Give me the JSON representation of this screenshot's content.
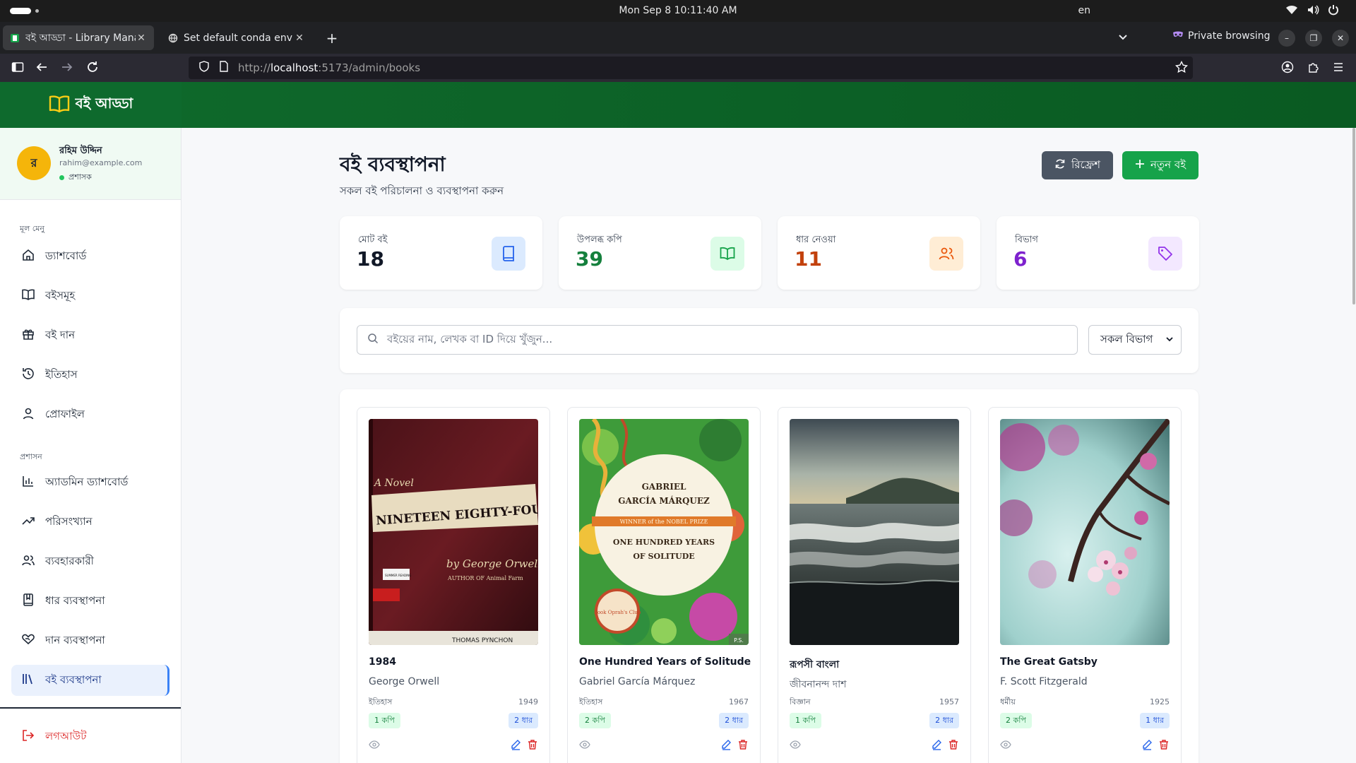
{
  "os": {
    "clock": "Mon Sep 8  10:11:40 AM",
    "lang": "en"
  },
  "browser": {
    "tabs": [
      {
        "title": "বই আড্ডা - Library Management",
        "active": true
      },
      {
        "title": "Set default conda env",
        "active": false
      }
    ],
    "new_tab": "+",
    "private_label": "Private browsing",
    "url_scheme": "http://",
    "url_host": "localhost",
    "url_path": ":5173/admin/books"
  },
  "app": {
    "brand": "বই আড্ডা",
    "user": {
      "initial": "র",
      "name": "রহিম উদ্দিন",
      "email": "rahim@example.com",
      "role": "প্রশাসক"
    },
    "menu_section_main": "মূল মেনু",
    "menu_main": [
      {
        "label": "ড্যাশবোর্ড",
        "icon": "home-icon"
      },
      {
        "label": "বইসমূহ",
        "icon": "book-open-icon"
      },
      {
        "label": "বই দান",
        "icon": "gift-icon"
      },
      {
        "label": "ইতিহাস",
        "icon": "history-icon"
      },
      {
        "label": "প্রোফাইল",
        "icon": "user-icon"
      }
    ],
    "menu_section_admin": "প্রশাসন",
    "menu_admin": [
      {
        "label": "অ্যাডমিন ড্যাশবোর্ড",
        "icon": "bar-chart-icon"
      },
      {
        "label": "পরিসংখ্যান",
        "icon": "trending-up-icon"
      },
      {
        "label": "ব্যবহারকারী",
        "icon": "users-icon"
      },
      {
        "label": "ধার ব্যবস্থাপনা",
        "icon": "book-marked-icon"
      },
      {
        "label": "দান ব্যবস্থাপনা",
        "icon": "hand-heart-icon"
      },
      {
        "label": "বই ব্যবস্থাপনা",
        "icon": "library-icon",
        "active": true
      }
    ],
    "logout": "লগআউট"
  },
  "page": {
    "title": "বই ব্যবস্থাপনা",
    "subtitle": "সকল বই পরিচালনা ও ব্যবস্থাপনা করুন",
    "refresh_label": "রিফ্রেশ",
    "new_book_label": "নতুন বই"
  },
  "stats": [
    {
      "label": "মোট বই",
      "value": "18",
      "color": "#111827",
      "icon": "book-icon",
      "icon_bg": "#dbeafe",
      "icon_color": "#2563eb"
    },
    {
      "label": "উপলব্ধ কপি",
      "value": "39",
      "color": "#15803d",
      "icon": "book-open-icon",
      "icon_bg": "#dcfce7",
      "icon_color": "#16a34a"
    },
    {
      "label": "ধার নেওয়া",
      "value": "11",
      "color": "#c2410c",
      "icon": "users-icon",
      "icon_bg": "#ffedd5",
      "icon_color": "#ea580c"
    },
    {
      "label": "বিভাগ",
      "value": "6",
      "color": "#7e22ce",
      "icon": "tag-icon",
      "icon_bg": "#f3e8ff",
      "icon_color": "#9333ea"
    }
  ],
  "search": {
    "placeholder": "বইয়ের নাম, লেখক বা ID দিয়ে খুঁজুন...",
    "category_selected": "সকল বিভাগ"
  },
  "books": [
    {
      "title": "1984",
      "author": "George Orwell",
      "category": "ইতিহাস",
      "year": "1949",
      "copies": "1 কপি",
      "borrowed": "2 ধার",
      "cover": "nineteen-eighty-four-cover",
      "cover_text": [
        "A Novel",
        "NINETEEN EIGHTY-FOUR",
        "by George Orwell",
        "AUTHOR OF Animal Farm",
        "SUMMER READING",
        "THOMAS PYNCHON"
      ]
    },
    {
      "title": "One Hundred Years of Solitude",
      "author": "Gabriel García Márquez",
      "category": "ইতিহাস",
      "year": "1967",
      "copies": "2 কপি",
      "borrowed": "2 ধার",
      "cover": "hundred-years-cover",
      "cover_text": [
        "GABRIEL",
        "GARCÍA MÁRQUEZ",
        "WINNER of the NOBEL PRIZE",
        "ONE HUNDRED YEARS",
        "OF SOLITUDE",
        "Book Oprah's Club",
        "P.S."
      ]
    },
    {
      "title": "রূপসী বাংলা",
      "author": "জীবনানন্দ দাশ",
      "category": "বিজ্ঞান",
      "year": "1957",
      "copies": "1 কপি",
      "borrowed": "2 ধার",
      "cover": "sea-shore-photo"
    },
    {
      "title": "The Great Gatsby",
      "author": "F. Scott Fitzgerald",
      "category": "ধর্মীয়",
      "year": "1925",
      "copies": "2 কপি",
      "borrowed": "1 ধার",
      "cover": "cherry-blossom-photo"
    }
  ]
}
